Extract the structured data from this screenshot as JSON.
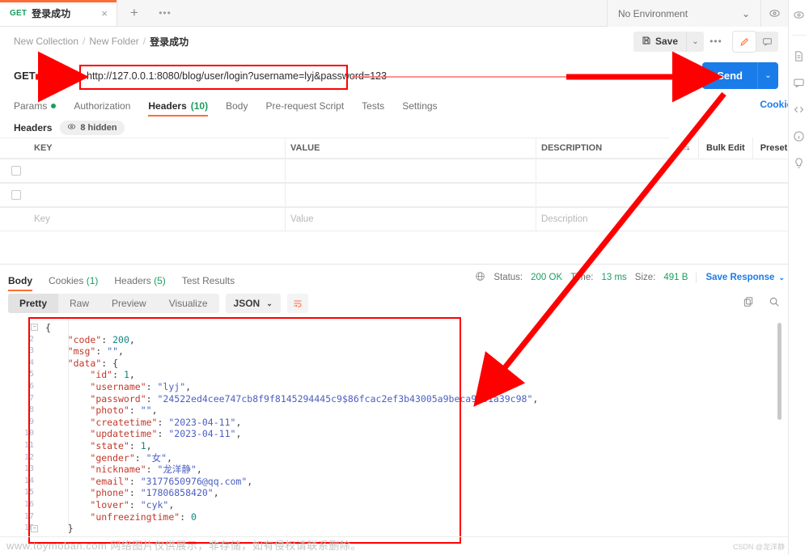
{
  "tab": {
    "method": "GET",
    "name": "登录成功",
    "close_label": "×",
    "new_tab_label": "+",
    "more_label": "•••"
  },
  "environment": {
    "selected": "No Environment",
    "chevron": "⌄"
  },
  "breadcrumb": {
    "items": [
      "New Collection",
      "New Folder",
      "登录成功"
    ],
    "separator": "/"
  },
  "toolbar": {
    "save_label": "Save",
    "save_chevron": "⌄",
    "more_label": "•••"
  },
  "request": {
    "method": "GET",
    "url": "http://127.0.0.1:8080/blog/user/login?username=lyj&password=123",
    "send_label": "Send",
    "send_chevron": "⌄",
    "cookies_label": "Cookies",
    "tabs": [
      {
        "label": "Params",
        "dot": true,
        "active": false
      },
      {
        "label": "Authorization",
        "active": false
      },
      {
        "label": "Headers",
        "count": "(10)",
        "active": true
      },
      {
        "label": "Body",
        "active": false
      },
      {
        "label": "Pre-request Script",
        "active": false
      },
      {
        "label": "Tests",
        "active": false
      },
      {
        "label": "Settings",
        "active": false
      }
    ]
  },
  "headers_panel": {
    "title": "Headers",
    "hidden_badge": "8 hidden",
    "columns": [
      "KEY",
      "VALUE",
      "DESCRIPTION"
    ],
    "bulk_edit_label": "Bulk Edit",
    "presets_label": "Presets",
    "presets_chevron": "⌄",
    "rows": [
      {
        "key": "",
        "value": "",
        "description": ""
      },
      {
        "key": "",
        "value": "",
        "description": ""
      }
    ],
    "placeholders": {
      "key": "Key",
      "value": "Value",
      "description": "Description"
    }
  },
  "response": {
    "tabs": [
      {
        "label": "Body",
        "active": true
      },
      {
        "label": "Cookies",
        "count": "(1)",
        "active": false
      },
      {
        "label": "Headers",
        "count": "(5)",
        "active": false
      },
      {
        "label": "Test Results",
        "active": false
      }
    ],
    "status_label": "Status:",
    "status_value": "200 OK",
    "time_label": "Time:",
    "time_value": "13 ms",
    "size_label": "Size:",
    "size_value": "491 B",
    "save_response_label": "Save Response",
    "save_response_chevron": "⌄",
    "view_modes": [
      {
        "label": "Pretty",
        "active": true
      },
      {
        "label": "Raw",
        "active": false
      },
      {
        "label": "Preview",
        "active": false
      },
      {
        "label": "Visualize",
        "active": false
      }
    ],
    "format": "JSON",
    "format_chevron": "⌄",
    "line_numbers": [
      "1",
      "2",
      "3",
      "4",
      "5",
      "6",
      "7",
      "8",
      "9",
      "10",
      "11",
      "12",
      "13",
      "14",
      "15",
      "16",
      "17",
      "18"
    ],
    "body_lines": [
      {
        "indent": 0,
        "segs": [
          {
            "t": "{",
            "c": "p"
          }
        ]
      },
      {
        "indent": 1,
        "segs": [
          {
            "t": "\"code\"",
            "c": "k"
          },
          {
            "t": ": ",
            "c": "p"
          },
          {
            "t": "200",
            "c": "n"
          },
          {
            "t": ",",
            "c": "p"
          }
        ]
      },
      {
        "indent": 1,
        "segs": [
          {
            "t": "\"msg\"",
            "c": "k"
          },
          {
            "t": ": ",
            "c": "p"
          },
          {
            "t": "\"\"",
            "c": "s"
          },
          {
            "t": ",",
            "c": "p"
          }
        ]
      },
      {
        "indent": 1,
        "segs": [
          {
            "t": "\"data\"",
            "c": "k"
          },
          {
            "t": ": ",
            "c": "p"
          },
          {
            "t": "{",
            "c": "p"
          }
        ]
      },
      {
        "indent": 2,
        "segs": [
          {
            "t": "\"id\"",
            "c": "k"
          },
          {
            "t": ": ",
            "c": "p"
          },
          {
            "t": "1",
            "c": "n"
          },
          {
            "t": ",",
            "c": "p"
          }
        ]
      },
      {
        "indent": 2,
        "segs": [
          {
            "t": "\"username\"",
            "c": "k"
          },
          {
            "t": ": ",
            "c": "p"
          },
          {
            "t": "\"lyj\"",
            "c": "s"
          },
          {
            "t": ",",
            "c": "p"
          }
        ]
      },
      {
        "indent": 2,
        "segs": [
          {
            "t": "\"password\"",
            "c": "k"
          },
          {
            "t": ": ",
            "c": "p"
          },
          {
            "t": "\"24522ed4cee747cb8f9f8145294445c9$86fcac2ef3b43005a9beca9f01a39c98\"",
            "c": "s"
          },
          {
            "t": ",",
            "c": "p"
          }
        ]
      },
      {
        "indent": 2,
        "segs": [
          {
            "t": "\"photo\"",
            "c": "k"
          },
          {
            "t": ": ",
            "c": "p"
          },
          {
            "t": "\"\"",
            "c": "s"
          },
          {
            "t": ",",
            "c": "p"
          }
        ]
      },
      {
        "indent": 2,
        "segs": [
          {
            "t": "\"createtime\"",
            "c": "k"
          },
          {
            "t": ": ",
            "c": "p"
          },
          {
            "t": "\"2023-04-11\"",
            "c": "s"
          },
          {
            "t": ",",
            "c": "p"
          }
        ]
      },
      {
        "indent": 2,
        "segs": [
          {
            "t": "\"updatetime\"",
            "c": "k"
          },
          {
            "t": ": ",
            "c": "p"
          },
          {
            "t": "\"2023-04-11\"",
            "c": "s"
          },
          {
            "t": ",",
            "c": "p"
          }
        ]
      },
      {
        "indent": 2,
        "segs": [
          {
            "t": "\"state\"",
            "c": "k"
          },
          {
            "t": ": ",
            "c": "p"
          },
          {
            "t": "1",
            "c": "n"
          },
          {
            "t": ",",
            "c": "p"
          }
        ]
      },
      {
        "indent": 2,
        "segs": [
          {
            "t": "\"gender\"",
            "c": "k"
          },
          {
            "t": ": ",
            "c": "p"
          },
          {
            "t": "\"女\"",
            "c": "s"
          },
          {
            "t": ",",
            "c": "p"
          }
        ]
      },
      {
        "indent": 2,
        "segs": [
          {
            "t": "\"nickname\"",
            "c": "k"
          },
          {
            "t": ": ",
            "c": "p"
          },
          {
            "t": "\"龙洋静\"",
            "c": "s"
          },
          {
            "t": ",",
            "c": "p"
          }
        ]
      },
      {
        "indent": 2,
        "segs": [
          {
            "t": "\"email\"",
            "c": "k"
          },
          {
            "t": ": ",
            "c": "p"
          },
          {
            "t": "\"3177650976@qq.com\"",
            "c": "s"
          },
          {
            "t": ",",
            "c": "p"
          }
        ]
      },
      {
        "indent": 2,
        "segs": [
          {
            "t": "\"phone\"",
            "c": "k"
          },
          {
            "t": ": ",
            "c": "p"
          },
          {
            "t": "\"17806858420\"",
            "c": "s"
          },
          {
            "t": ",",
            "c": "p"
          }
        ]
      },
      {
        "indent": 2,
        "segs": [
          {
            "t": "\"lover\"",
            "c": "k"
          },
          {
            "t": ": ",
            "c": "p"
          },
          {
            "t": "\"cyk\"",
            "c": "s"
          },
          {
            "t": ",",
            "c": "p"
          }
        ]
      },
      {
        "indent": 2,
        "segs": [
          {
            "t": "\"unfreezingtime\"",
            "c": "k"
          },
          {
            "t": ": ",
            "c": "p"
          },
          {
            "t": "0",
            "c": "n"
          }
        ]
      },
      {
        "indent": 1,
        "segs": [
          {
            "t": "}",
            "c": "p"
          }
        ]
      }
    ]
  },
  "rail_icons": [
    "eye-icon",
    "documentation-icon",
    "comment-icon",
    "code-icon",
    "info-icon",
    "lightbulb-icon"
  ],
  "annotations": {
    "highlight_color": "#ff0000",
    "url_box": "url-highlight-box",
    "json_box": "response-highlight-box"
  },
  "watermarks": {
    "bottom": "www.toymoban.com 网络图片仅供展示，非存储，如有侵权请联系删除。",
    "csdn": "CSDN @龙洋静"
  }
}
